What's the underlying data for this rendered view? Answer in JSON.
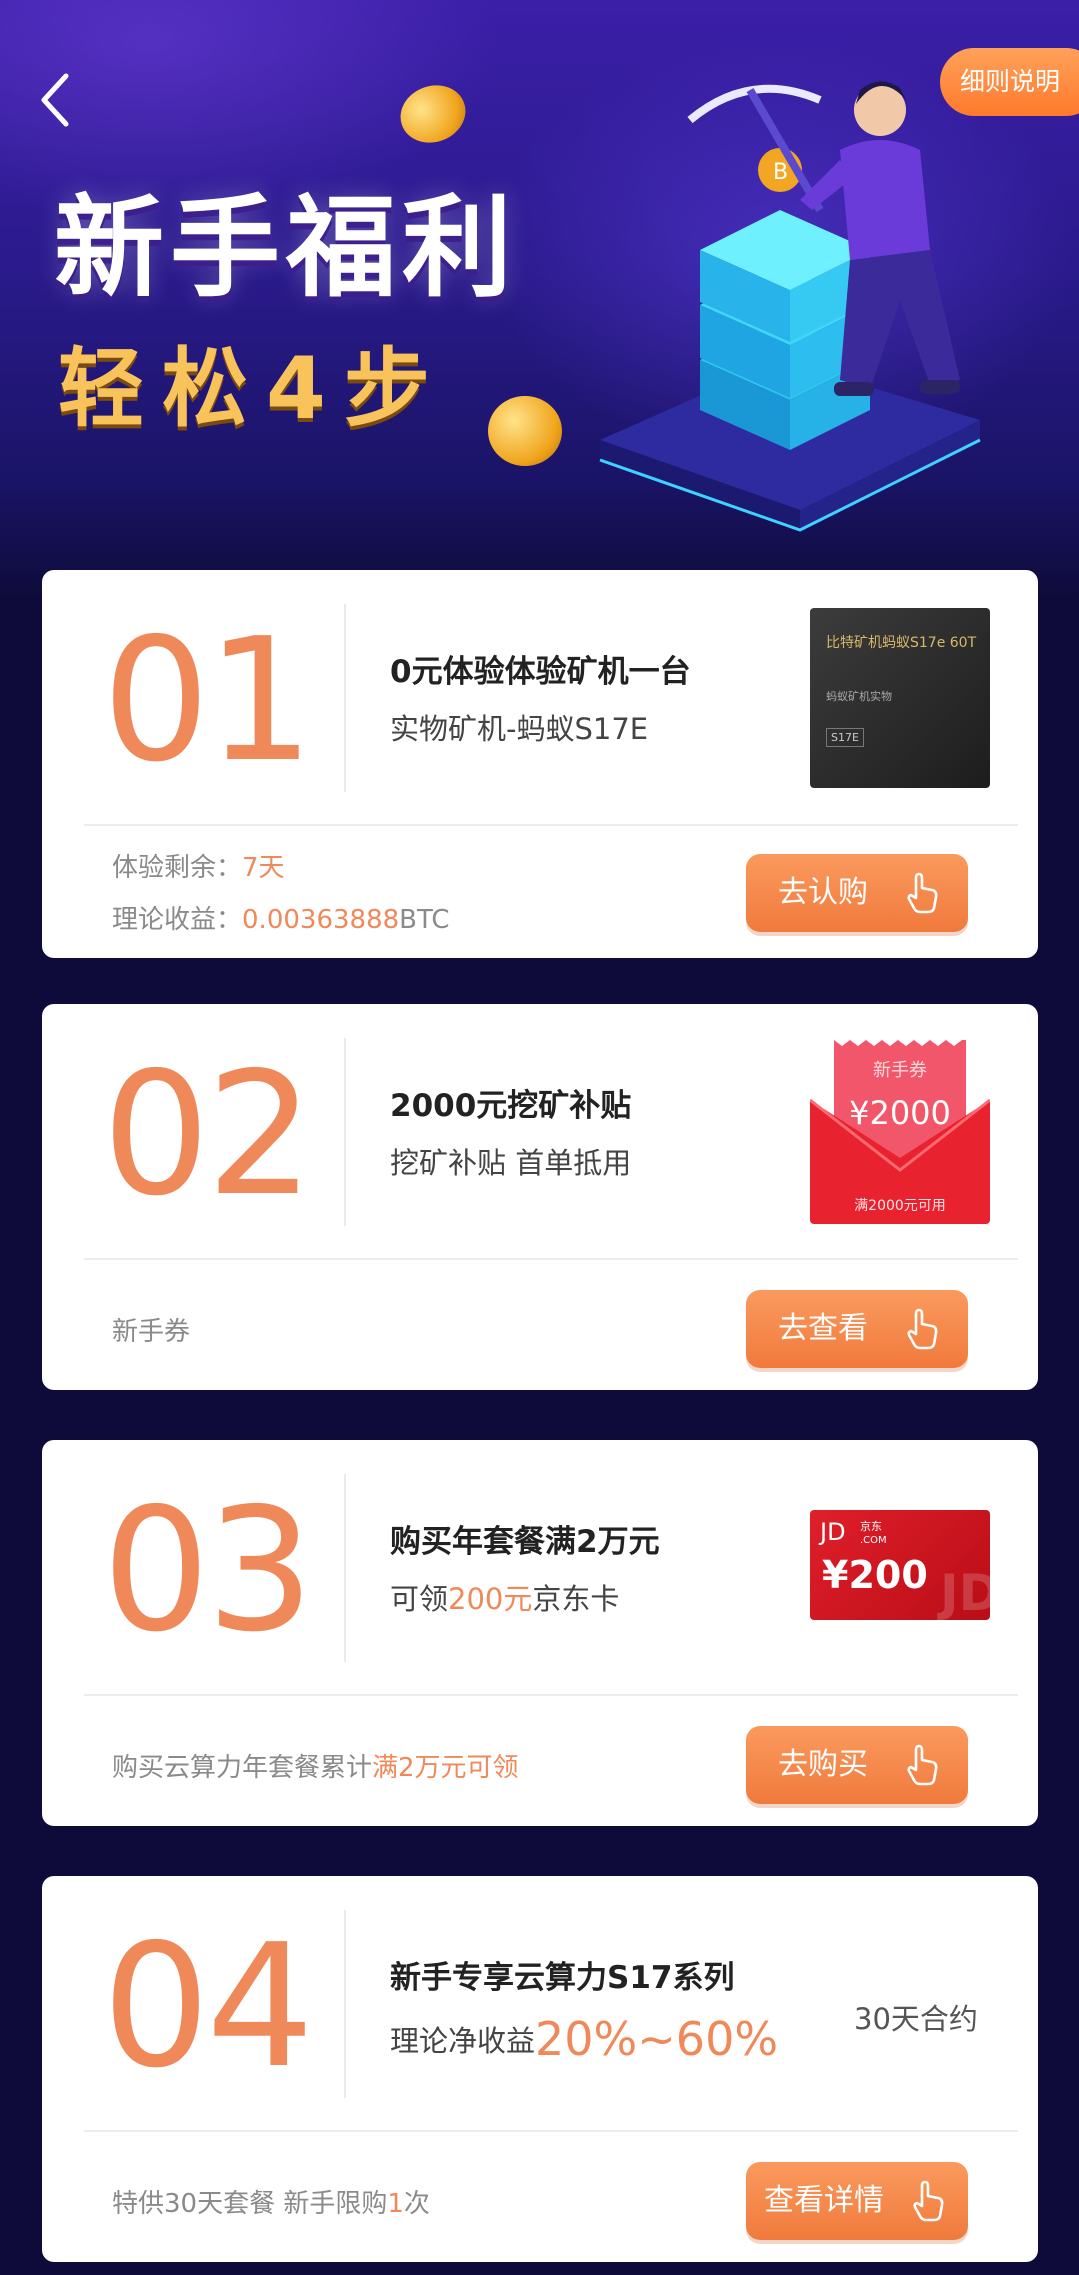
{
  "header": {
    "rules_label": "细则说明",
    "title": "新手福利",
    "subtitle": "轻松4步"
  },
  "steps": [
    {
      "num": "01",
      "title": "0元体验体验矿机一台",
      "subtitle": "实物矿机-蚂蚁S17E",
      "info1_label": "体验剩余：",
      "info1_value": "7天",
      "info2_label": "理论收益：",
      "info2_value": "0.00363888",
      "info2_unit": "BTC",
      "cta": "去认购",
      "thumb": {
        "line1": "比特矿机蚂蚁S17e 60T",
        "line2": "蚂蚁矿机实物",
        "line3": "S17E"
      }
    },
    {
      "num": "02",
      "title": "2000元挖矿补贴",
      "subtitle": "挖矿补贴 首单抵用",
      "footer": "新手券",
      "cta": "去查看",
      "coupon": {
        "tag": "新手券",
        "amount": "¥2000",
        "condition": "满2000元可用"
      }
    },
    {
      "num": "03",
      "title": "购买年套餐满2万元",
      "subtitle_pre": "可领",
      "subtitle_hl": "200元",
      "subtitle_post": "京东卡",
      "footer_pre": "购买云算力年套餐累计",
      "footer_hl": "满2万元可领",
      "cta": "去购买",
      "jd": {
        "logo": "JD",
        "logo_sub1": "京东",
        "logo_sub2": ".COM",
        "amount": "¥200"
      }
    },
    {
      "num": "04",
      "title": "新手专享云算力S17系列",
      "subtitle_pre": "理论净收益",
      "subtitle_hl": "20%~60%",
      "contract": "30天合约",
      "footer_pre": "特供30天套餐 新手限购",
      "footer_hl": "1",
      "footer_post": "次",
      "cta": "查看详情"
    }
  ],
  "colors": {
    "accent": "#f0895a",
    "button": "#f07a3c",
    "hero": "#2a1a8c",
    "page_bg": "#0e0b3a"
  },
  "icons": [
    "back-arrow-icon",
    "hand-pointer-icon",
    "bitcoin-coin-icon"
  ]
}
